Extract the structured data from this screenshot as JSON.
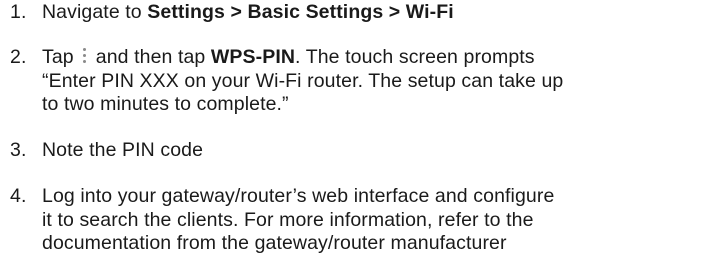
{
  "steps": [
    {
      "number": "1.",
      "text": "Navigate to ",
      "bold": "Settings > Basic Settings > Wi-Fi"
    },
    {
      "number": "2.",
      "text_before_icon": "Tap",
      "icon": "more-vertical-icon",
      "text_after_icon": "and then tap ",
      "bold": "WPS-PIN",
      "text_after_bold": ". The touch screen prompts",
      "line2": "“Enter PIN XXX on your Wi-Fi router. The setup can take up",
      "line3": "to two minutes to complete.”"
    },
    {
      "number": "3.",
      "text": "Note the PIN code"
    },
    {
      "number": "4.",
      "line1": "Log into your gateway/router’s web interface and configure",
      "line2": "it to search the clients. For more information, refer to the",
      "line3": "documentation from the gateway/router manufacturer"
    }
  ]
}
